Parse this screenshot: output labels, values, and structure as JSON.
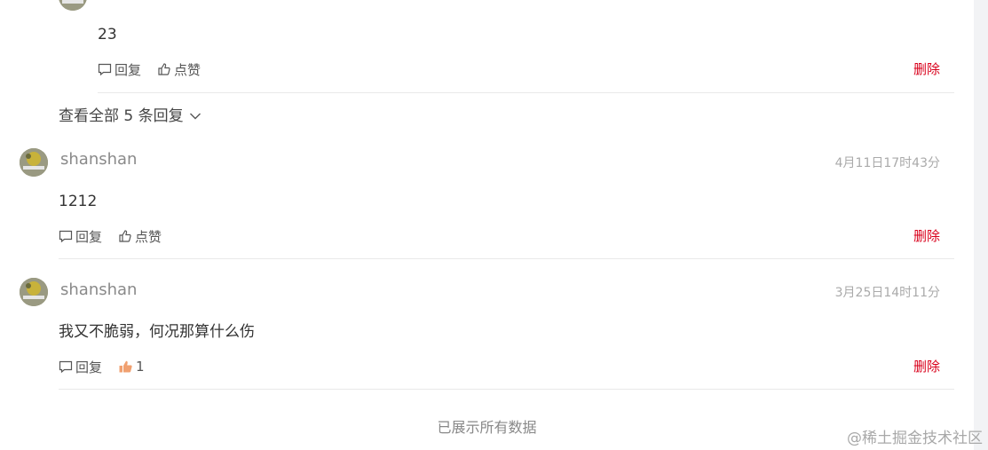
{
  "reply": {
    "content": "23",
    "reply_label": "回复",
    "like_label": "点赞",
    "delete_label": "删除"
  },
  "view_all": "查看全部 5 条回复",
  "comments": [
    {
      "username": "shanshan",
      "time": "4月11日17时43分",
      "content": "1212",
      "reply_label": "回复",
      "like_label": "点赞",
      "delete_label": "删除"
    },
    {
      "username": "shanshan",
      "time": "3月25日14时11分",
      "content": "我又不脆弱，何况那算什么伤",
      "reply_label": "回复",
      "like_count": "1",
      "delete_label": "删除"
    }
  ],
  "footer_text": "已展示所有数据",
  "watermark": "@稀土掘金技术社区",
  "colors": {
    "delete": "#d9001b",
    "liked": "#f0a070",
    "time": "#aaaaaa"
  }
}
